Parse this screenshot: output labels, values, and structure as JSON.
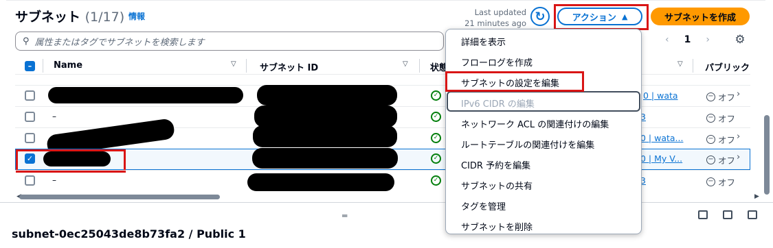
{
  "header": {
    "title": "サブネット",
    "count": "(1/17)",
    "info_link": "情報",
    "last_updated_line1": "Last updated",
    "last_updated_line2": "21 minutes ago",
    "actions_label": "アクション",
    "create_label": "サブネットを作成"
  },
  "search": {
    "placeholder": "属性またはタグでサブネットを検索します"
  },
  "pagination": {
    "prev": "‹",
    "page": "1",
    "next": "›"
  },
  "table": {
    "columns": [
      "Name",
      "サブネット ID",
      "状態",
      "パブリック"
    ],
    "rows": [
      {
        "name": "",
        "checked": false,
        "vpc": "0 | wata",
        "public": "オフ"
      },
      {
        "name": "–",
        "checked": false,
        "vpc": "3",
        "public": "オフ"
      },
      {
        "name": "",
        "checked": false,
        "vpc": "0 | wata...",
        "public": "オフ"
      },
      {
        "name": "",
        "checked": true,
        "vpc": "0 | My V...",
        "public": "オフ"
      },
      {
        "name": "–",
        "checked": false,
        "vpc": "3",
        "public": "オフ"
      }
    ]
  },
  "detail": {
    "title": "subnet-0ec25043de8b73fa2 / Public 1"
  },
  "actions_menu": {
    "items": [
      {
        "label": "詳細を表示",
        "disabled": false
      },
      {
        "label": "フローログを作成",
        "disabled": false
      },
      {
        "label": "サブネットの設定を編集",
        "disabled": false
      },
      {
        "label": "IPv6 CIDR の編集",
        "disabled": true
      },
      {
        "label": "ネットワーク ACL の関連付けの編集",
        "disabled": false
      },
      {
        "label": "ルートテーブルの関連付けを編集",
        "disabled": false
      },
      {
        "label": "CIDR 予約を編集",
        "disabled": false
      },
      {
        "label": "サブネットの共有",
        "disabled": false
      },
      {
        "label": "タグを管理",
        "disabled": false
      },
      {
        "label": "サブネットを削除",
        "disabled": false
      }
    ]
  },
  "colors": {
    "accent": "#0972d3",
    "primary_button": "#ff9900",
    "highlight": "#d91515",
    "success": "#037f0c"
  },
  "icons": [
    "search-icon",
    "refresh-icon",
    "caret-up-icon",
    "gear-icon",
    "sort-icon",
    "status-available-icon",
    "off-icon"
  ]
}
